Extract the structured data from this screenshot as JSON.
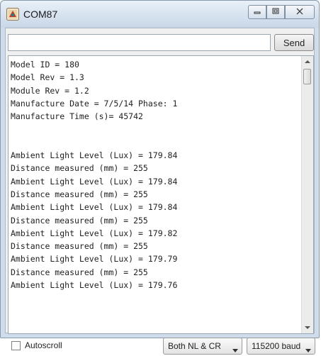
{
  "window": {
    "title": "COM87"
  },
  "send": {
    "input_value": "",
    "button_label": "Send"
  },
  "serial_output": {
    "lines": [
      "Model ID = 180",
      "Model Rev = 1.3",
      "Module Rev = 1.2",
      "Manufacture Date = 7/5/14 Phase: 1",
      "Manufacture Time (s)= 45742",
      "",
      "",
      "Ambient Light Level (Lux) = 179.84",
      "Distance measured (mm) = 255",
      "Ambient Light Level (Lux) = 179.84",
      "Distance measured (mm) = 255",
      "Ambient Light Level (Lux) = 179.84",
      "Distance measured (mm) = 255",
      "Ambient Light Level (Lux) = 179.82",
      "Distance measured (mm) = 255",
      "Ambient Light Level (Lux) = 179.79",
      "Distance measured (mm) = 255",
      "Ambient Light Level (Lux) = 179.76"
    ]
  },
  "footer": {
    "autoscroll_label": "Autoscroll",
    "autoscroll_checked": false,
    "line_ending": "Both NL & CR",
    "baud_rate": "115200 baud"
  },
  "icons": {
    "app": "arduino-app-icon",
    "minimize": "minimize-icon",
    "maximize": "maximize-icon",
    "close": "close-icon"
  }
}
